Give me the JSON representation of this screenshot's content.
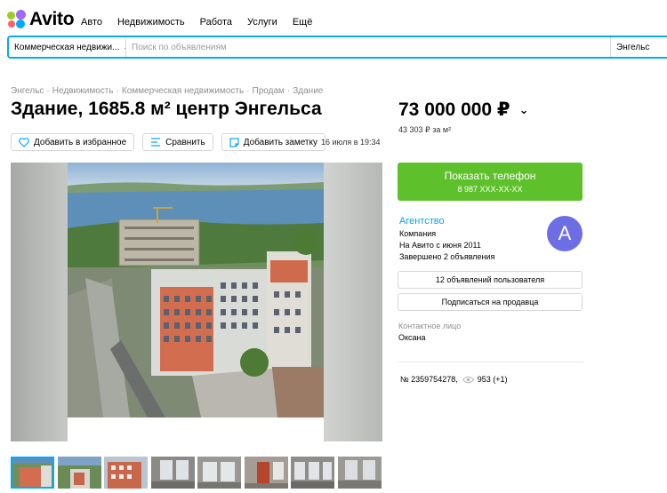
{
  "brand": {
    "name": "Avito"
  },
  "nav": {
    "items": [
      "Авто",
      "Недвижимость",
      "Работа",
      "Услуги",
      "Ещё"
    ]
  },
  "search": {
    "category": "Коммерческая недвижи...",
    "placeholder": "Поиск по объявлениям",
    "city": "Энгельс"
  },
  "breadcrumb": [
    "Энгельс",
    "Недвижимость",
    "Коммерческая недвижимость",
    "Продам",
    "Здание"
  ],
  "listing": {
    "title": "Здание, 1685.8 м² центр Энгельса",
    "price": "73 000 000 ₽",
    "price_per_m2": "43 303 ₽ за м²",
    "date": "16 июля в 19:34",
    "actions": {
      "favorite": "Добавить в избранное",
      "compare": "Сравнить",
      "note": "Добавить заметку"
    },
    "id_text": "№ 2359754278,",
    "views": "953 (+1)"
  },
  "phone": {
    "label": "Показать телефон",
    "number": "8 987 XXX-XX-XX"
  },
  "seller": {
    "name": "Агентство",
    "type": "Компания",
    "since": "На Авито с июня 2011",
    "completed": "Завершено 2 объявления",
    "avatar_letter": "A",
    "avatar_color": "#6e6ee4",
    "listings_button": "12 объявлений пользователя",
    "subscribe_button": "Подписаться на продавца"
  },
  "contact": {
    "label": "Контактное лицо",
    "name": "Оксана"
  },
  "gallery": {
    "thumb_count": 8,
    "active_index": 0
  },
  "colors": {
    "accent": "#00aaff",
    "phone_button": "#5ec12b",
    "link": "#0aa0e8"
  }
}
